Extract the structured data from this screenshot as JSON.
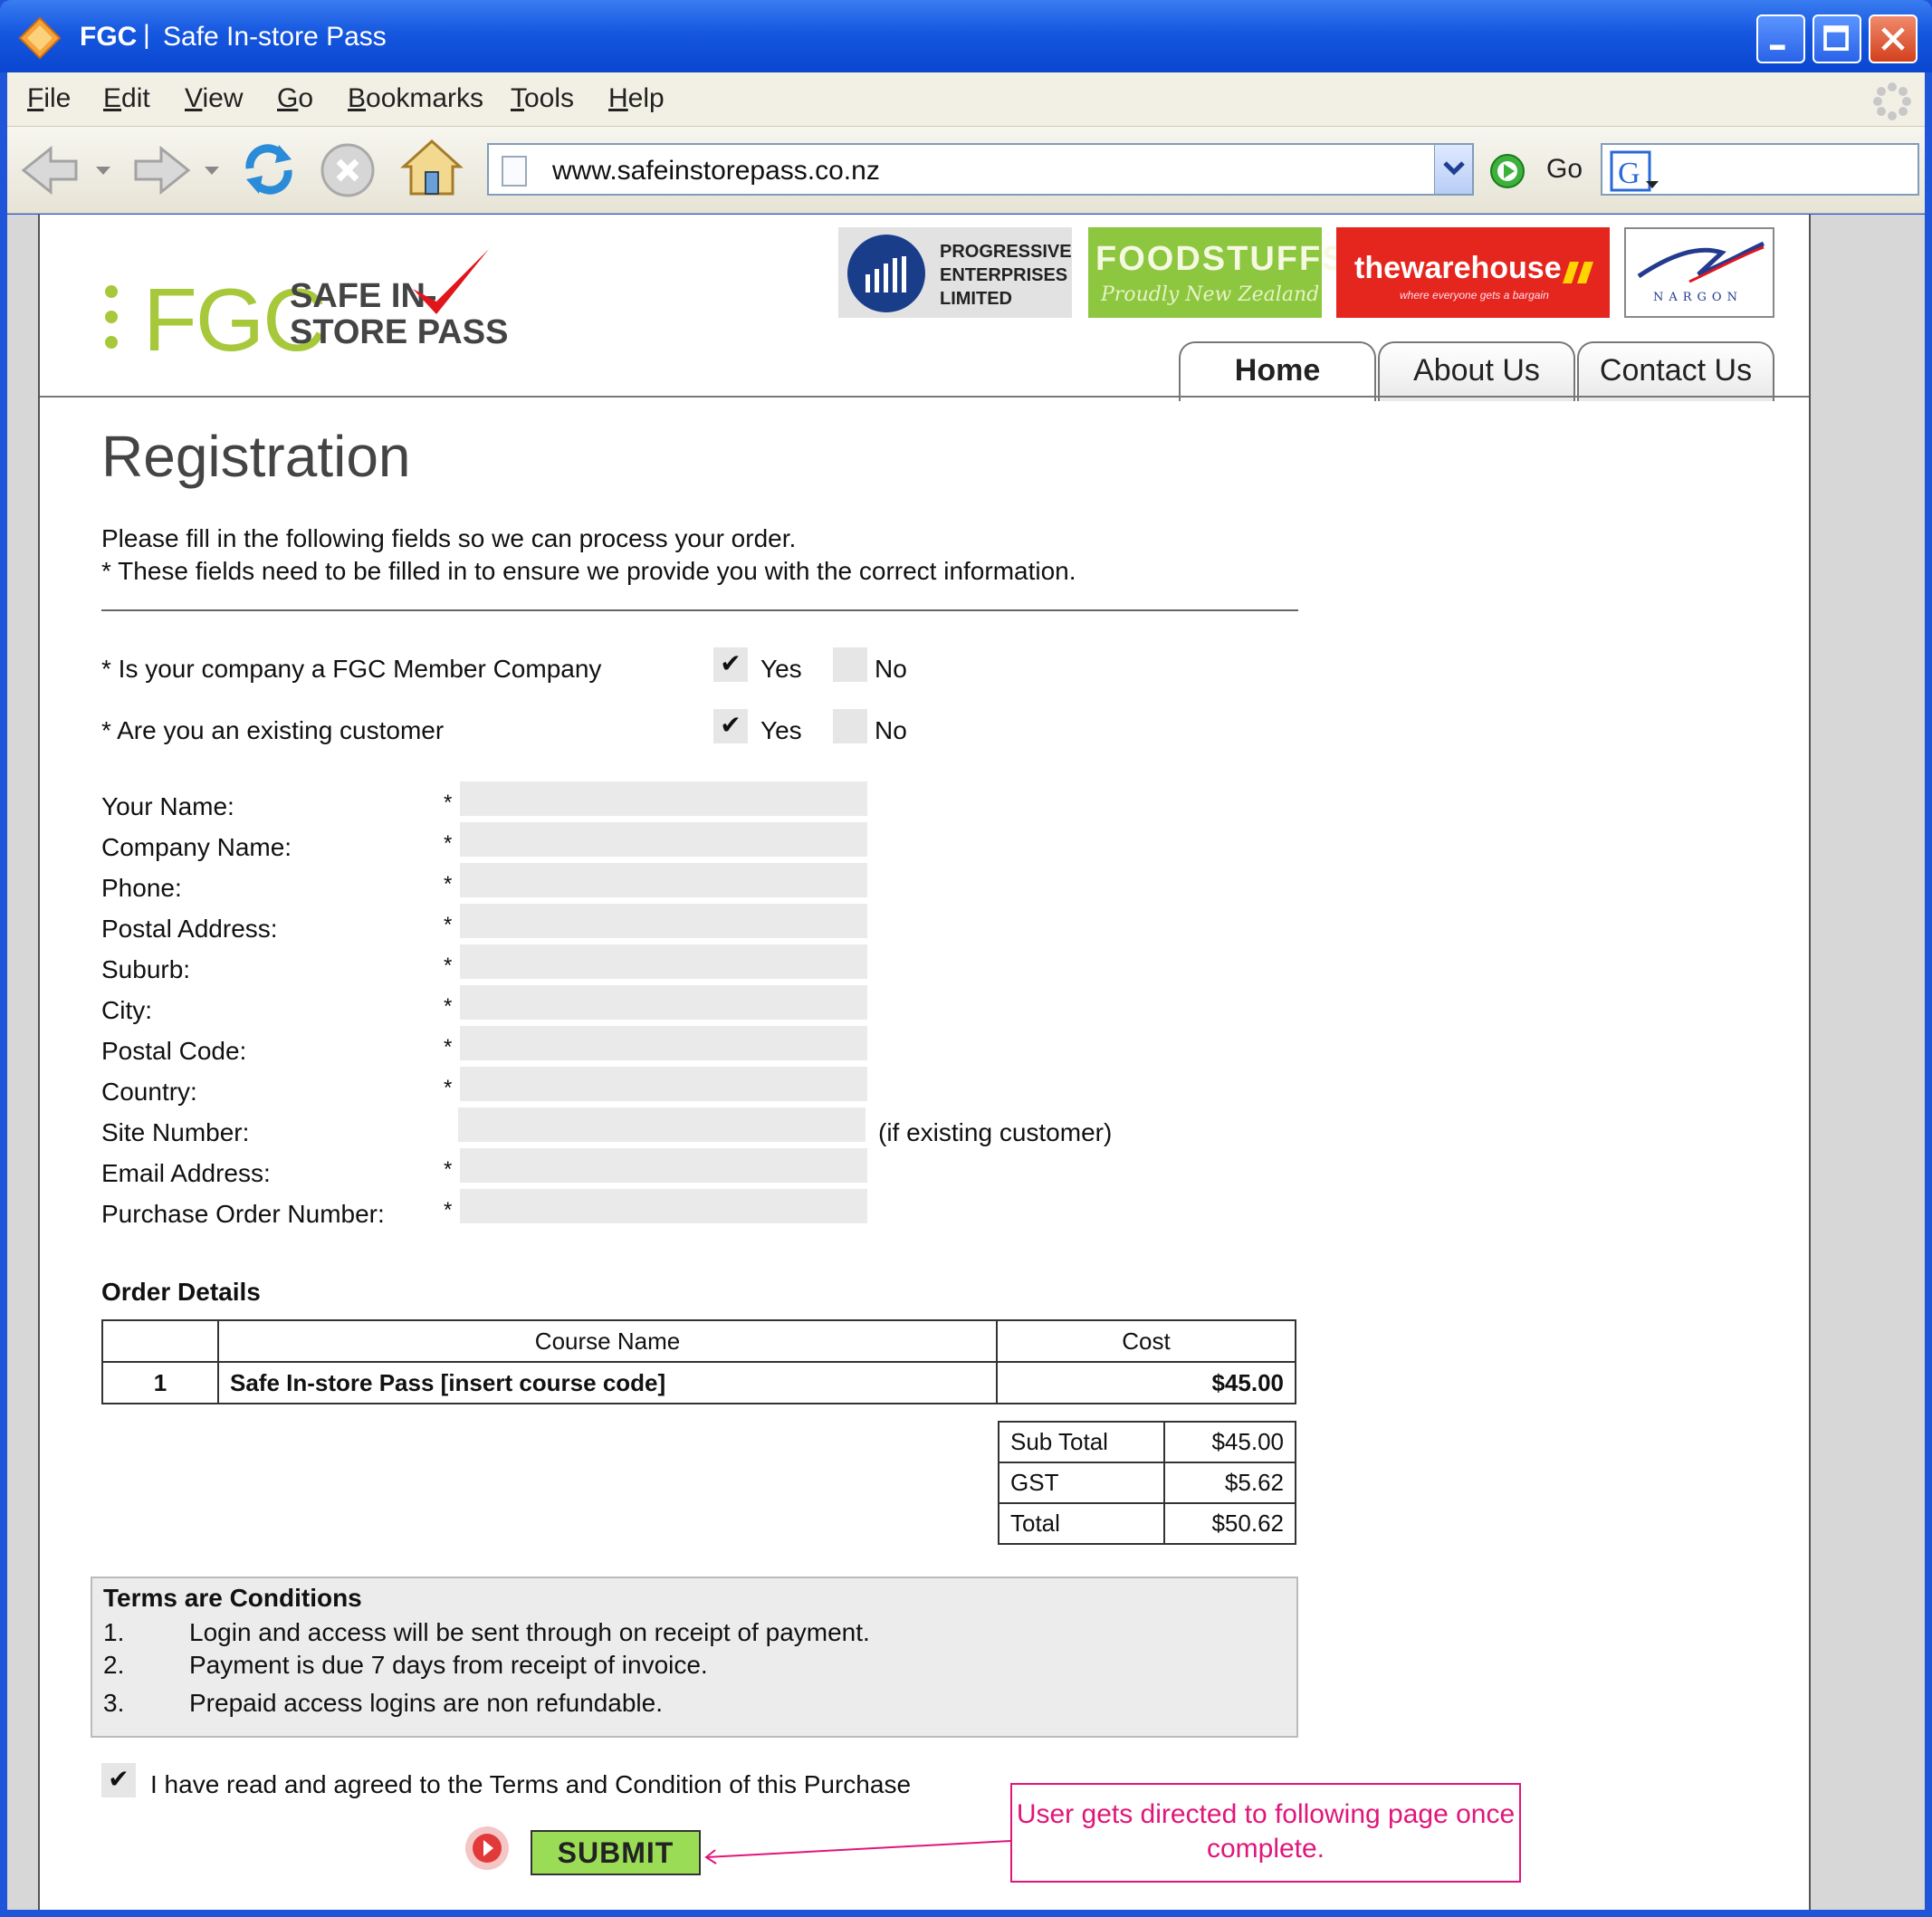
{
  "window": {
    "app_name": "FGC",
    "separator": "|",
    "page_title": "Safe In-store Pass"
  },
  "menu": [
    "File",
    "Edit",
    "View",
    "Go",
    "Bookmarks",
    "Tools",
    "Help"
  ],
  "toolbar": {
    "url": "www.safeinstorepass.co.nz",
    "go_label": "Go"
  },
  "header": {
    "logo_main": "FGC",
    "logo_sub_1": "SAFE IN-",
    "logo_sub_2": "STORE PASS",
    "partners": {
      "progressive": [
        "PROGRESSIVE",
        "ENTERPRISES",
        "LIMITED"
      ],
      "foodstuffs": [
        "FOODSTUFFS",
        "Proudly New Zealand"
      ],
      "warehouse": [
        "thewarehouse",
        "where everyone gets a bargain"
      ],
      "nargon": "NARGON"
    },
    "tabs": [
      "Home",
      "About Us",
      "Contact Us"
    ]
  },
  "registration": {
    "title": "Registration",
    "intro_1": "Please fill in the following fields so we can process your order.",
    "intro_2": "* These fields need to be filled in to ensure we provide you with the correct information.",
    "questions": [
      {
        "label": "* Is your company a FGC Member Company",
        "yes": "Yes",
        "no": "No",
        "selected": "Yes"
      },
      {
        "label": "* Are you an existing customer",
        "yes": "Yes",
        "no": "No",
        "selected": "Yes"
      }
    ],
    "fields": [
      {
        "label": "Your Name:",
        "required": "*",
        "value": ""
      },
      {
        "label": "Company Name:",
        "required": "*",
        "value": ""
      },
      {
        "label": "Phone:",
        "required": "*",
        "value": ""
      },
      {
        "label": "Postal Address:",
        "required": "*",
        "value": ""
      },
      {
        "label": "Suburb:",
        "required": "*",
        "value": ""
      },
      {
        "label": "City:",
        "required": "*",
        "value": ""
      },
      {
        "label": "Postal Code:",
        "required": "*",
        "value": ""
      },
      {
        "label": "Country:",
        "required": "*",
        "value": ""
      },
      {
        "label": "Site Number:",
        "required": "",
        "value": "",
        "note": "(if existing customer)"
      },
      {
        "label": "Email Address:",
        "required": "*",
        "value": ""
      },
      {
        "label": "Purchase Order Number:",
        "required": "*",
        "value": ""
      }
    ]
  },
  "order": {
    "title": "Order Details",
    "headers": [
      "",
      "Course Name",
      "Cost"
    ],
    "rows": [
      {
        "num": "1",
        "course": "Safe In-store Pass [insert course code]",
        "cost": "$45.00"
      }
    ],
    "totals": [
      {
        "label": "Sub Total",
        "value": "$45.00"
      },
      {
        "label": "GST",
        "value": "$5.62"
      },
      {
        "label": "Total",
        "value": "$50.62"
      }
    ]
  },
  "terms": {
    "title": "Terms are Conditions",
    "items": [
      {
        "num": "1.",
        "text": "Login and access will be sent through on receipt of payment."
      },
      {
        "num": "2.",
        "text": "Payment is due 7 days from receipt of invoice."
      },
      {
        "num": "3.",
        "text": "Prepaid access logins are non refundable."
      }
    ]
  },
  "agreement": {
    "text": "I have read and agreed to the Terms and Condition of this Purchase",
    "checked": true
  },
  "submit_label": "SUBMIT",
  "annotation": "User gets directed to following page once complete.",
  "colors": {
    "title_bar": "#1657e0",
    "logo_green": "#a7c83a",
    "submit_green": "#9bdc56",
    "annotation_pink": "#e0167a",
    "warehouse_red": "#e5261e",
    "foodstuffs_green": "#8dc63f"
  }
}
